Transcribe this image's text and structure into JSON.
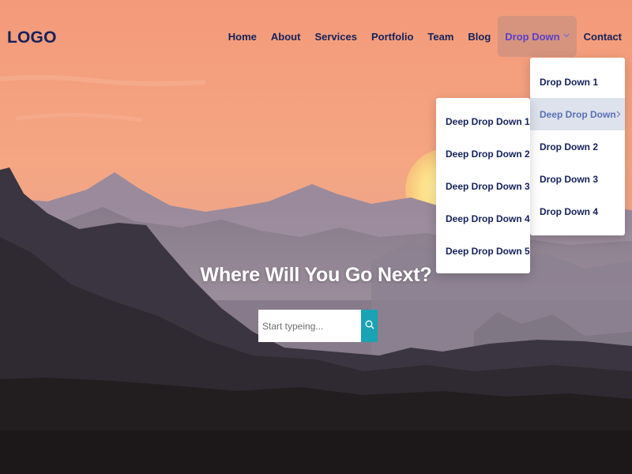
{
  "header": {
    "logo": "LOGO",
    "nav": [
      {
        "label": "Home",
        "name": "nav-home"
      },
      {
        "label": "About",
        "name": "nav-about"
      },
      {
        "label": "Services",
        "name": "nav-services"
      },
      {
        "label": "Portfolio",
        "name": "nav-portfolio"
      },
      {
        "label": "Team",
        "name": "nav-team"
      },
      {
        "label": "Blog",
        "name": "nav-blog"
      },
      {
        "label": "Drop Down",
        "name": "nav-drop-down"
      },
      {
        "label": "Contact",
        "name": "nav-contact"
      }
    ]
  },
  "dropdown": {
    "items": [
      "Drop Down 1",
      "Deep Drop Down",
      "Drop Down 2",
      "Drop Down 3",
      "Drop Down 4"
    ]
  },
  "deep_dropdown": {
    "items": [
      "Deep Drop Down 1",
      "Deep Drop Down 2",
      "Deep Drop Down 3",
      "Deep Drop Down 4",
      "Deep Drop Down 5"
    ]
  },
  "hero": {
    "title": "Where Will You Go Next?",
    "search_placeholder": "Start typeing..."
  },
  "icons": {
    "chevron": "chevron-down-icon",
    "submenu_arrow": "chevron-right-icon",
    "search": "search-icon"
  },
  "colors": {
    "nav_text": "#14215a",
    "active_nav_text": "#5a3fc9",
    "search_button": "#1aa3b5",
    "sky_top": "#f29c7c"
  }
}
